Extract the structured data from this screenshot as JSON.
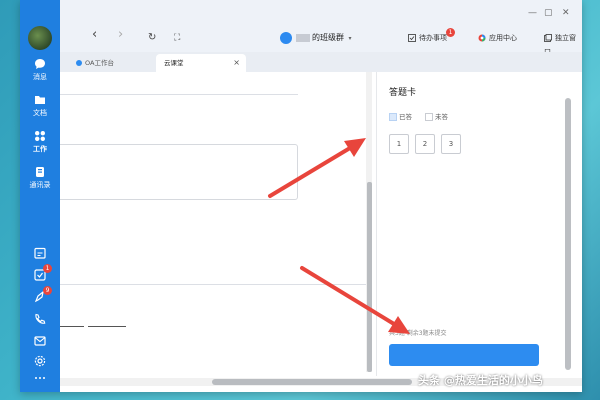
{
  "window": {
    "controls": [
      "—",
      "▢",
      "✕"
    ]
  },
  "rail": {
    "items": [
      {
        "label": "消息",
        "icon": "message-icon"
      },
      {
        "label": "文档",
        "icon": "document-icon"
      },
      {
        "label": "工作",
        "icon": "work-icon"
      },
      {
        "label": "通讯录",
        "icon": "contacts-icon"
      }
    ],
    "bottom_badges": [
      "1",
      "9"
    ]
  },
  "toolbar": {
    "back": "‹",
    "forward": "›",
    "refresh": "↻",
    "expand": "⛶",
    "group_name": "的班级群",
    "todo_label": "待办事项",
    "todo_badge": "1",
    "app_center_label": "应用中心",
    "standalone_label": "独立窗口"
  },
  "tabs": [
    {
      "label": "OA工作台"
    },
    {
      "label": "云课堂",
      "close": "×"
    }
  ],
  "answer_card": {
    "title": "答题卡",
    "legend_answered": "已答",
    "legend_unanswered": "未答",
    "questions": [
      "1",
      "2",
      "3"
    ],
    "hint": "共3题 剩余3题未提交"
  },
  "watermark": "头条 @热爱生活的小小鸟",
  "colors": {
    "rail": "#1f7fe0",
    "accent": "#2d8cf0",
    "arrow": "#e8453c"
  }
}
